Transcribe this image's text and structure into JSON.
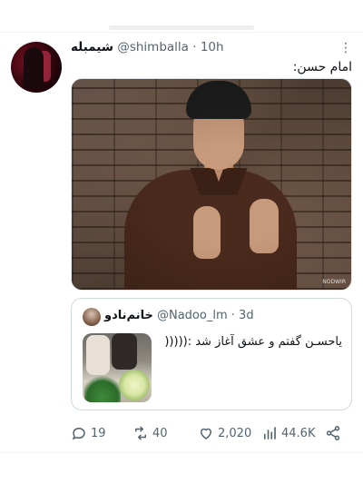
{
  "tweet": {
    "display_name": "شیمبله",
    "handle": "@shimballa",
    "separator": "·",
    "time": "10h",
    "text": "امام حسن:",
    "image": {
      "watermark": "NODWIR"
    }
  },
  "quoted_tweet": {
    "display_name": "خانم‌نادو",
    "handle": "@Nadoo_lm",
    "separator": "·",
    "time": "3d",
    "text": "یاحسـن گفتم و عشق آغاز شد :((((("
  },
  "actions": {
    "replies": "19",
    "retweets": "40",
    "likes": "2,020",
    "views": "44.6K"
  },
  "icons": {
    "more": "more-icon",
    "reply": "reply-icon",
    "retweet": "retweet-icon",
    "like": "heart-icon",
    "views": "views-icon",
    "share": "share-icon"
  },
  "colors": {
    "text_primary": "#0f1419",
    "text_secondary": "#536471",
    "border": "#cfd9de"
  }
}
